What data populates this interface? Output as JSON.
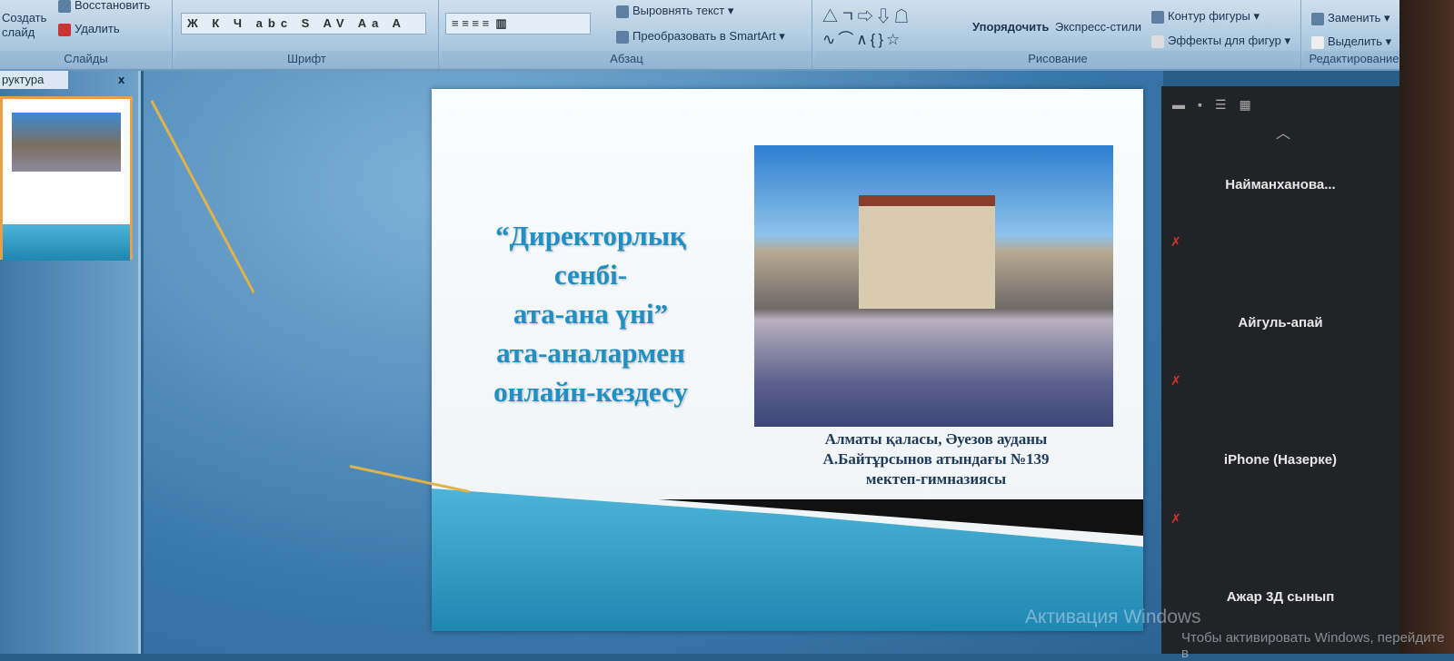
{
  "ribbon": {
    "slides": {
      "new_slide": "Создать слайд",
      "restore": "Восстановить",
      "delete": "Удалить",
      "label": "Слайды"
    },
    "font": {
      "buttons": "Ж К Ч abc S AV Aa A",
      "label": "Шрифт"
    },
    "paragraph": {
      "align_text": "Выровнять текст",
      "smartart": "Преобразовать в SmartArt",
      "label": "Абзац"
    },
    "drawing": {
      "arrange": "Упорядочить",
      "quick_styles": "Экспресс-стили",
      "outline": "Контур фигуры",
      "effects": "Эффекты для фигур",
      "label": "Рисование"
    },
    "editing": {
      "replace": "Заменить",
      "select": "Выделить",
      "label": "Редактирование"
    }
  },
  "panel": {
    "tab": "руктура",
    "close": "x"
  },
  "slide": {
    "title_lines": [
      "“Директорлық",
      "сенбі-",
      "ата-ана үні”",
      "ата-аналармен",
      "онлайн-кездесу"
    ],
    "caption_lines": [
      "Алматы қаласы, Әуезов ауданы",
      "А.Байтұрсынов атындағы №139",
      "мектеп-гимназиясы"
    ]
  },
  "participants": [
    {
      "name": "Найманханова...",
      "muted": true
    },
    {
      "name": "Айгуль-апай",
      "muted": true
    },
    {
      "name": "iPhone (Назерке)",
      "muted": true
    },
    {
      "name": "Ажар 3Д сынып",
      "muted": false
    }
  ],
  "watermark": {
    "title": "Активация Windows",
    "subtitle": "Чтобы активировать Windows, перейдите в"
  },
  "colors": {
    "title": "#1f8fc4",
    "muted_mic": "#d8322e"
  }
}
